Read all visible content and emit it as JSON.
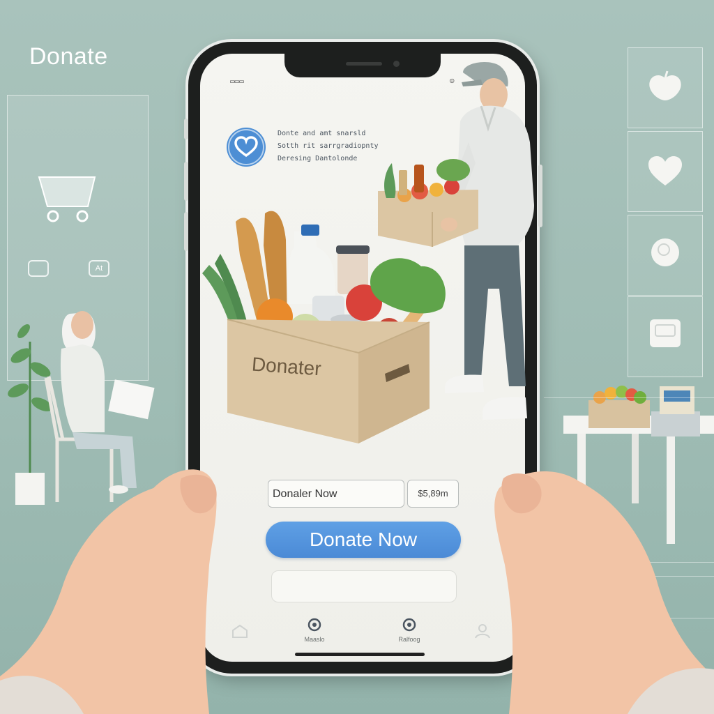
{
  "background": {
    "title": "Donate",
    "panel_buttons": [
      "",
      "At"
    ],
    "side_tiles": [
      "apple-icon",
      "heart-icon",
      "jar-icon",
      "container-icon"
    ]
  },
  "status_bar": {
    "left": "▭▭▭",
    "right": "☺"
  },
  "app": {
    "blurb_lines": [
      "Donte and amt snarsld",
      "Sotth rit sarrgradiopnty",
      "Deresing Dantolonde"
    ],
    "box_label": "Donater",
    "field_value": "Donaler Now",
    "amount_value": "$5,89m",
    "primary_button": "Donate Now",
    "nav_items": [
      {
        "icon": "home-icon",
        "label": ""
      },
      {
        "icon": "ring-icon",
        "label": "Maaslo"
      },
      {
        "icon": "ring-icon",
        "label": "Ralfoog"
      },
      {
        "icon": "profile-icon",
        "label": ""
      }
    ]
  },
  "colors": {
    "accent": "#4d8ed4",
    "background": "#a9c3bc",
    "box": "#dcc6a3"
  }
}
